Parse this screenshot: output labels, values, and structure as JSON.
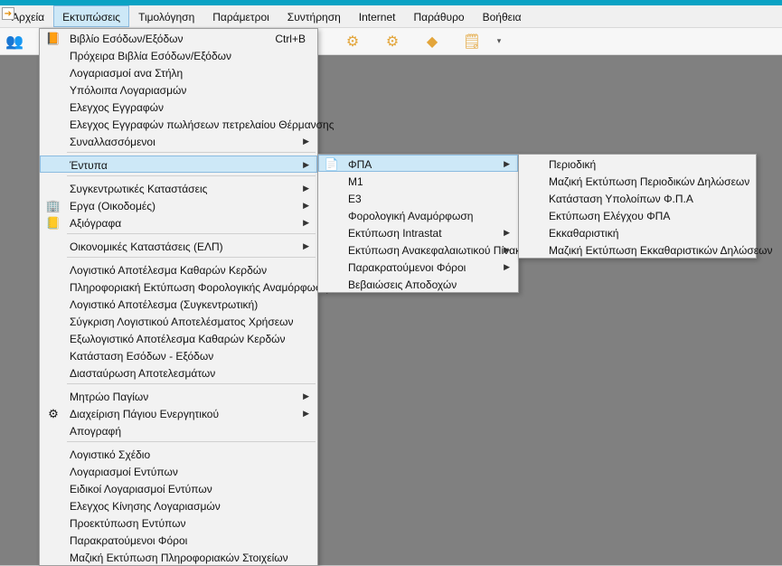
{
  "menubar": {
    "items": [
      {
        "label": "Αρχεία"
      },
      {
        "label": "Εκτυπώσεις"
      },
      {
        "label": "Τιμολόγηση"
      },
      {
        "label": "Παράμετροι"
      },
      {
        "label": "Συντήρηση"
      },
      {
        "label": "Internet"
      },
      {
        "label": "Παράθυρο"
      },
      {
        "label": "Βοήθεια"
      }
    ],
    "active_index": 1
  },
  "menu1": {
    "items": [
      {
        "label": "Βιβλίο Εσόδων/Εξόδων",
        "shortcut": "Ctrl+B",
        "icon": "book-icon"
      },
      {
        "label": "Πρόχειρα Βιβλία Εσόδων/Εξόδων"
      },
      {
        "label": "Λογαριασμοί ανα Στήλη"
      },
      {
        "label": "Υπόλοιπα Λογαριασμών"
      },
      {
        "label": "Ελεγχος Εγγραφών"
      },
      {
        "label": "Ελεγχος Εγγραφών πωλήσεων πετρελαίου Θέρμανσης"
      },
      {
        "label": "Συναλλασσόμενοι",
        "sub": true
      },
      {
        "sep": true
      },
      {
        "label": "Έντυπα",
        "sub": true,
        "highlight": true
      },
      {
        "sep": true
      },
      {
        "label": "Συγκεντρωτικές Καταστάσεις",
        "sub": true
      },
      {
        "label": "Εργα (Οικοδομές)",
        "sub": true,
        "icon": "building-icon"
      },
      {
        "label": "Αξιόγραφα",
        "sub": true,
        "icon": "note-icon"
      },
      {
        "sep": true
      },
      {
        "label": "Οικονομικές Καταστάσεις (ΕΛΠ)",
        "sub": true
      },
      {
        "sep": true
      },
      {
        "label": "Λογιστικό Αποτέλεσμα Καθαρών Κερδών"
      },
      {
        "label": "Πληροφοριακή Εκτύπωση Φορολογικής Αναμόρφωσης"
      },
      {
        "label": "Λογιστικό Αποτέλεσμα (Συγκεντρωτική)"
      },
      {
        "label": "Σύγκριση Λογιστικού Αποτελέσματος Χρήσεων"
      },
      {
        "label": "Εξωλογιστικό Αποτέλεσμα Καθαρών Κερδών"
      },
      {
        "label": "Κατάσταση Εσόδων - Εξόδων"
      },
      {
        "label": "Διασταύρωση Αποτελεσμάτων"
      },
      {
        "sep": true
      },
      {
        "label": "Μητρώο Παγίων",
        "sub": true
      },
      {
        "label": "Διαχείριση Πάγιου Ενεργητικού",
        "sub": true,
        "icon": "gears-icon"
      },
      {
        "label": "Απογραφή"
      },
      {
        "sep": true
      },
      {
        "label": "Λογιστικό Σχέδιο"
      },
      {
        "label": "Λογαριασμοί Εντύπων"
      },
      {
        "label": "Ειδικοί Λογαριασμοί Εντύπων"
      },
      {
        "label": "Ελεγχος Κίνησης Λογαριασμών"
      },
      {
        "label": "Προεκτύπωση Εντύπων"
      },
      {
        "label": "Παρακρατούμενοι Φόροι"
      },
      {
        "label": "Μαζική Εκτύπωση Πληροφοριακών Στοιχείων"
      }
    ]
  },
  "menu2": {
    "items": [
      {
        "label": "ΦΠΑ",
        "sub": true,
        "highlight": true,
        "icon": "doc-icon"
      },
      {
        "label": "Μ1"
      },
      {
        "label": "Ε3"
      },
      {
        "label": "Φορολογική Αναμόρφωση"
      },
      {
        "label": "Εκτύπωση Intrastat",
        "sub": true
      },
      {
        "label": "Εκτύπωση Ανακεφαλαιωτικού Πίνακα",
        "sub": true
      },
      {
        "label": "Παρακρατούμενοι Φόροι",
        "sub": true
      },
      {
        "label": "Βεβαιώσεις Αποδοχών"
      }
    ]
  },
  "menu3": {
    "items": [
      {
        "label": "Περιοδική"
      },
      {
        "label": "Μαζική Εκτύπωση Περιοδικών Δηλώσεων"
      },
      {
        "label": "Κατάσταση Υπολοίπων Φ.Π.Α"
      },
      {
        "label": "Εκτύπωση Ελέγχου ΦΠΑ"
      },
      {
        "label": "Εκκαθαριστική"
      },
      {
        "label": "Μαζική Εκτύπωση Εκκαθαριστικών Δηλώσεων"
      }
    ]
  }
}
